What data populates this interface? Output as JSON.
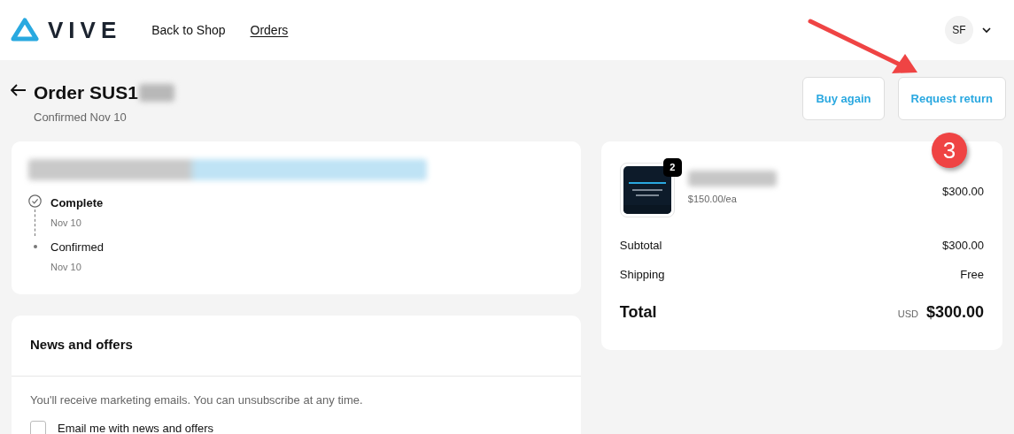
{
  "header": {
    "brand": "VIVE",
    "nav": [
      {
        "label": "Back to Shop",
        "selected": false
      },
      {
        "label": "Orders",
        "selected": true
      }
    ],
    "avatar": "SF"
  },
  "order": {
    "title": "Order SUS1",
    "subtitle": "Confirmed Nov 10",
    "actions": [
      "Buy again",
      "Request return"
    ]
  },
  "status_card": {
    "timeline": [
      {
        "kind": "complete",
        "label": "Complete",
        "date": "Nov 10"
      },
      {
        "kind": "step",
        "label": "Confirmed",
        "date": "Nov 10"
      }
    ]
  },
  "news": {
    "title": "News and offers",
    "text": "You'll receive marketing emails. You can unsubscribe at any time.",
    "checkbox": {
      "label": "Email me with news and offers",
      "checked": false
    }
  },
  "summary": {
    "item": {
      "quantity": "2",
      "unit_price": "$150.00/ea",
      "price": "$300.00"
    },
    "rows": [
      {
        "label": "Subtotal",
        "value": "$300.00"
      },
      {
        "label": "Shipping",
        "value": "Free"
      }
    ],
    "total": {
      "label": "Total",
      "currency": "USD",
      "value": "$300.00"
    }
  },
  "annotation": {
    "step": "3"
  }
}
